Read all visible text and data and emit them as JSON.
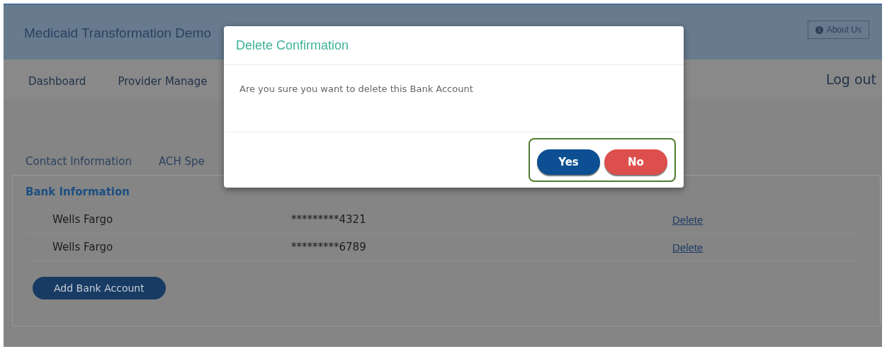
{
  "header": {
    "title": "Medicaid Transformation Demo",
    "about_button": "About Us"
  },
  "nav": {
    "items": [
      {
        "label": "Dashboard"
      },
      {
        "label": "Provider Manage"
      }
    ],
    "logout": "Log out"
  },
  "tabs": [
    {
      "label": "Contact Information"
    },
    {
      "label": "ACH Spe"
    }
  ],
  "bank_panel": {
    "title": "Bank Information",
    "rows": [
      {
        "bank": "Wells Fargo",
        "account": "*********4321",
        "action": "Delete"
      },
      {
        "bank": "Wells Fargo",
        "account": "*********6789",
        "action": "Delete"
      }
    ],
    "add_button": "Add Bank Account"
  },
  "dialog": {
    "title": "Delete Confirmation",
    "message": "Are you sure you want to delete this Bank Account",
    "buttons": [
      {
        "label": "Yes",
        "kind": "primary"
      },
      {
        "label": "No",
        "kind": "danger"
      }
    ],
    "highlighted": true
  }
}
